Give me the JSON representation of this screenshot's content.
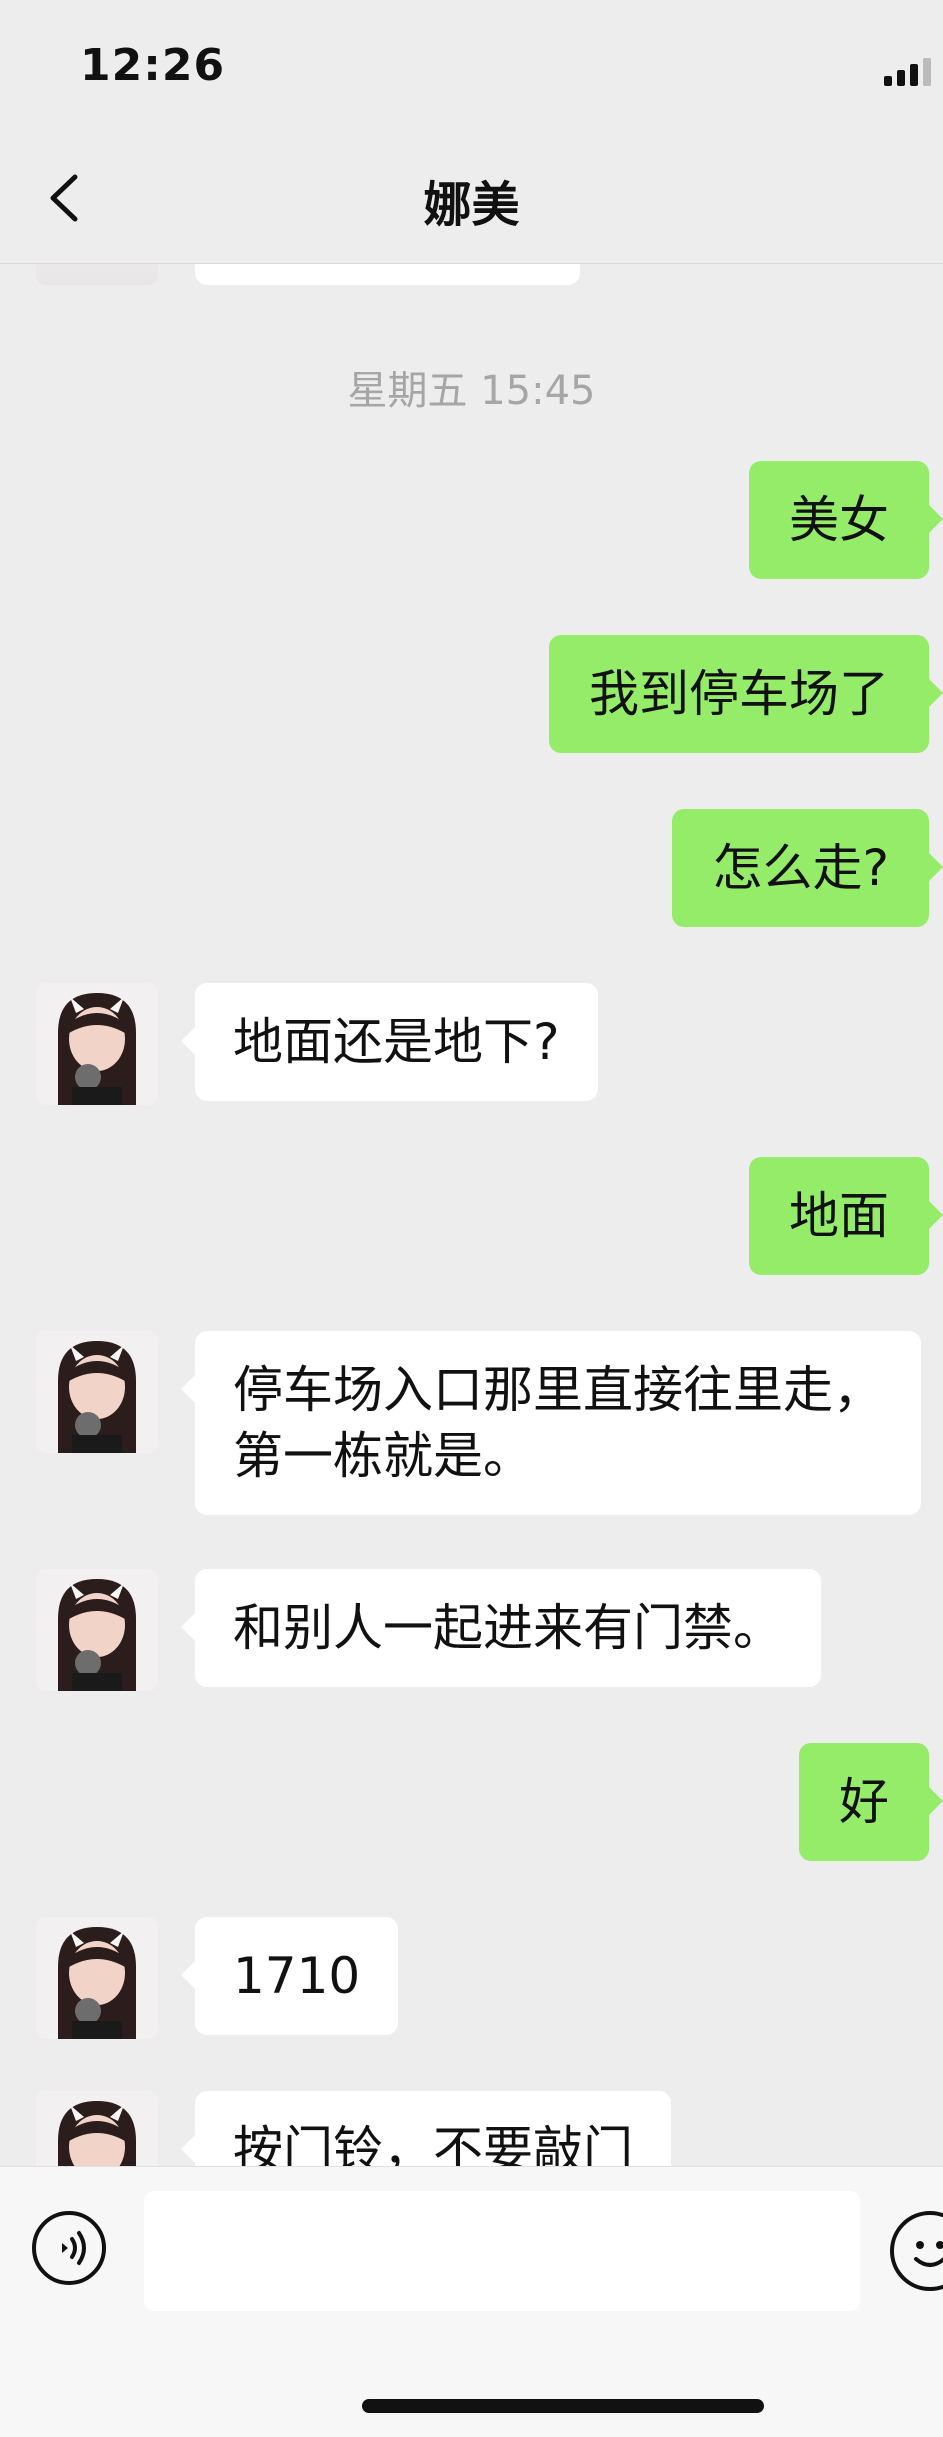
{
  "status_bar": {
    "time": "12:26"
  },
  "header": {
    "title": "娜美"
  },
  "chat": {
    "timestamp": "星期五 15:45",
    "messages": [
      {
        "side": "right",
        "text": "美女"
      },
      {
        "side": "right",
        "text": "我到停车场了"
      },
      {
        "side": "right",
        "text": "怎么走?"
      },
      {
        "side": "left",
        "text": "地面还是地下?"
      },
      {
        "side": "right",
        "text": "地面"
      },
      {
        "side": "left",
        "text": "停车场入口那里直接往里走，\n第一栋就是。"
      },
      {
        "side": "left",
        "text": "和别人一起进来有门禁。"
      },
      {
        "side": "right",
        "text": "好"
      },
      {
        "side": "left",
        "text": "1710"
      },
      {
        "side": "left",
        "text": "按门铃，不要敲门"
      }
    ]
  },
  "input_bar": {
    "placeholder": ""
  },
  "colors": {
    "sent_bubble": "#95ec69",
    "received_bubble": "#ffffff",
    "background": "#ededed"
  },
  "icons": [
    "back-icon",
    "signal-icon",
    "voice-icon",
    "emoji-icon"
  ]
}
